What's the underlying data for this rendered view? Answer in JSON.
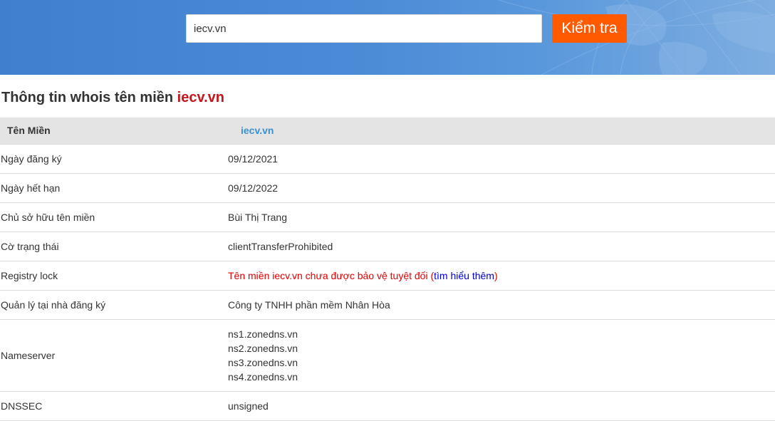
{
  "search": {
    "value": "iecv.vn",
    "button_label": "Kiểm tra"
  },
  "title": {
    "prefix": "Thông tin whois tên miền ",
    "domain": "iecv.vn"
  },
  "table": {
    "header": {
      "key": "Tên Miền",
      "value": "iecv.vn"
    },
    "registered": {
      "key": "Ngày đăng ký",
      "value": "09/12/2021"
    },
    "expires": {
      "key": "Ngày hết hạn",
      "value": "09/12/2022"
    },
    "owner": {
      "key": "Chủ sở hữu tên miền",
      "value": "Bùi Thị Trang"
    },
    "status": {
      "key": "Cờ trạng thái",
      "value": "clientTransferProhibited"
    },
    "registry_lock": {
      "key": "Registry lock",
      "warning": "Tên miền iecv.vn chưa được bảo vệ tuyệt đối (",
      "link": "tìm hiểu thêm",
      "close": ")"
    },
    "registrar": {
      "key": "Quản lý tại nhà đăng ký",
      "value": "Công ty TNHH phần mềm Nhân Hòa"
    },
    "nameserver": {
      "key": "Nameserver",
      "values": [
        "ns1.zonedns.vn",
        "ns2.zonedns.vn",
        "ns3.zonedns.vn",
        "ns4.zonedns.vn"
      ]
    },
    "dnssec": {
      "key": "DNSSEC",
      "value": "unsigned"
    }
  },
  "colors": {
    "accent": "#ff5a00",
    "banner": "#4a8ad6",
    "domain_red": "#c4161c",
    "header_link": "#3b8fd4",
    "warning": "#e60000",
    "link": "#0000cc"
  }
}
